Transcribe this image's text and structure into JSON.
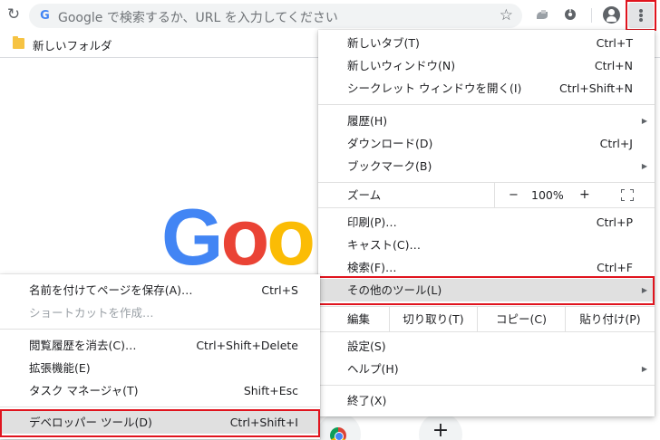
{
  "omnibox": {
    "g_letter": "G",
    "placeholder": "Google で検索するか、URL を入力してください"
  },
  "bookmarks": [
    {
      "label": "新しいフォルダ"
    }
  ],
  "page": {
    "logo_part1": "G",
    "logo_part2": "o",
    "logo_part3": "o",
    "new_shortcut": "+"
  },
  "main_menu": {
    "items": [
      {
        "label": "新しいタブ(T)",
        "shortcut": "Ctrl+T"
      },
      {
        "label": "新しいウィンドウ(N)",
        "shortcut": "Ctrl+N"
      },
      {
        "label": "シークレット ウィンドウを開く(I)",
        "shortcut": "Ctrl+Shift+N"
      },
      {
        "label": "履歴(H)",
        "shortcut": ""
      },
      {
        "label": "ダウンロード(D)",
        "shortcut": "Ctrl+J"
      },
      {
        "label": "ブックマーク(B)",
        "shortcut": ""
      },
      {
        "label": "印刷(P)…",
        "shortcut": "Ctrl+P"
      },
      {
        "label": "キャスト(C)…",
        "shortcut": ""
      },
      {
        "label": "検索(F)…",
        "shortcut": "Ctrl+F"
      },
      {
        "label": "その他のツール(L)",
        "shortcut": ""
      },
      {
        "label": "設定(S)",
        "shortcut": ""
      },
      {
        "label": "ヘルプ(H)",
        "shortcut": ""
      },
      {
        "label": "終了(X)",
        "shortcut": ""
      }
    ],
    "zoom": {
      "label": "ズーム",
      "minus": "−",
      "value": "100%",
      "plus": "+"
    },
    "edit": {
      "label": "編集",
      "cut": "切り取り(T)",
      "copy": "コピー(C)",
      "paste": "貼り付け(P)"
    }
  },
  "sub_menu": {
    "items": [
      {
        "label": "名前を付けてページを保存(A)…",
        "shortcut": "Ctrl+S"
      },
      {
        "label": "ショートカットを作成…",
        "shortcut": ""
      },
      {
        "label": "閲覧履歴を消去(C)…",
        "shortcut": "Ctrl+Shift+Delete"
      },
      {
        "label": "拡張機能(E)",
        "shortcut": ""
      },
      {
        "label": "タスク マネージャ(T)",
        "shortcut": "Shift+Esc"
      },
      {
        "label": "デベロッパー ツール(D)",
        "shortcut": "Ctrl+Shift+I"
      }
    ]
  },
  "colors": {
    "highlight_box": "#e0141e",
    "google_blue": "#4285f4",
    "google_red": "#ea4335",
    "google_yellow": "#fbbc05"
  }
}
